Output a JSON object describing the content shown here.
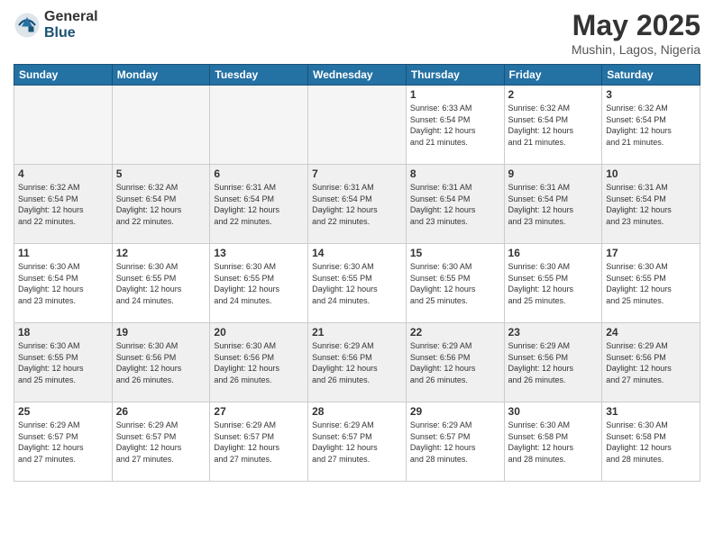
{
  "logo": {
    "general": "General",
    "blue": "Blue"
  },
  "title": "May 2025",
  "location": "Mushin, Lagos, Nigeria",
  "days_of_week": [
    "Sunday",
    "Monday",
    "Tuesday",
    "Wednesday",
    "Thursday",
    "Friday",
    "Saturday"
  ],
  "weeks": [
    [
      {
        "day": "",
        "info": "",
        "empty": true
      },
      {
        "day": "",
        "info": "",
        "empty": true
      },
      {
        "day": "",
        "info": "",
        "empty": true
      },
      {
        "day": "",
        "info": "",
        "empty": true
      },
      {
        "day": "1",
        "info": "Sunrise: 6:33 AM\nSunset: 6:54 PM\nDaylight: 12 hours\nand 21 minutes."
      },
      {
        "day": "2",
        "info": "Sunrise: 6:32 AM\nSunset: 6:54 PM\nDaylight: 12 hours\nand 21 minutes."
      },
      {
        "day": "3",
        "info": "Sunrise: 6:32 AM\nSunset: 6:54 PM\nDaylight: 12 hours\nand 21 minutes."
      }
    ],
    [
      {
        "day": "4",
        "info": "Sunrise: 6:32 AM\nSunset: 6:54 PM\nDaylight: 12 hours\nand 22 minutes."
      },
      {
        "day": "5",
        "info": "Sunrise: 6:32 AM\nSunset: 6:54 PM\nDaylight: 12 hours\nand 22 minutes."
      },
      {
        "day": "6",
        "info": "Sunrise: 6:31 AM\nSunset: 6:54 PM\nDaylight: 12 hours\nand 22 minutes."
      },
      {
        "day": "7",
        "info": "Sunrise: 6:31 AM\nSunset: 6:54 PM\nDaylight: 12 hours\nand 22 minutes."
      },
      {
        "day": "8",
        "info": "Sunrise: 6:31 AM\nSunset: 6:54 PM\nDaylight: 12 hours\nand 23 minutes."
      },
      {
        "day": "9",
        "info": "Sunrise: 6:31 AM\nSunset: 6:54 PM\nDaylight: 12 hours\nand 23 minutes."
      },
      {
        "day": "10",
        "info": "Sunrise: 6:31 AM\nSunset: 6:54 PM\nDaylight: 12 hours\nand 23 minutes."
      }
    ],
    [
      {
        "day": "11",
        "info": "Sunrise: 6:30 AM\nSunset: 6:54 PM\nDaylight: 12 hours\nand 23 minutes."
      },
      {
        "day": "12",
        "info": "Sunrise: 6:30 AM\nSunset: 6:55 PM\nDaylight: 12 hours\nand 24 minutes."
      },
      {
        "day": "13",
        "info": "Sunrise: 6:30 AM\nSunset: 6:55 PM\nDaylight: 12 hours\nand 24 minutes."
      },
      {
        "day": "14",
        "info": "Sunrise: 6:30 AM\nSunset: 6:55 PM\nDaylight: 12 hours\nand 24 minutes."
      },
      {
        "day": "15",
        "info": "Sunrise: 6:30 AM\nSunset: 6:55 PM\nDaylight: 12 hours\nand 25 minutes."
      },
      {
        "day": "16",
        "info": "Sunrise: 6:30 AM\nSunset: 6:55 PM\nDaylight: 12 hours\nand 25 minutes."
      },
      {
        "day": "17",
        "info": "Sunrise: 6:30 AM\nSunset: 6:55 PM\nDaylight: 12 hours\nand 25 minutes."
      }
    ],
    [
      {
        "day": "18",
        "info": "Sunrise: 6:30 AM\nSunset: 6:55 PM\nDaylight: 12 hours\nand 25 minutes."
      },
      {
        "day": "19",
        "info": "Sunrise: 6:30 AM\nSunset: 6:56 PM\nDaylight: 12 hours\nand 26 minutes."
      },
      {
        "day": "20",
        "info": "Sunrise: 6:30 AM\nSunset: 6:56 PM\nDaylight: 12 hours\nand 26 minutes."
      },
      {
        "day": "21",
        "info": "Sunrise: 6:29 AM\nSunset: 6:56 PM\nDaylight: 12 hours\nand 26 minutes."
      },
      {
        "day": "22",
        "info": "Sunrise: 6:29 AM\nSunset: 6:56 PM\nDaylight: 12 hours\nand 26 minutes."
      },
      {
        "day": "23",
        "info": "Sunrise: 6:29 AM\nSunset: 6:56 PM\nDaylight: 12 hours\nand 26 minutes."
      },
      {
        "day": "24",
        "info": "Sunrise: 6:29 AM\nSunset: 6:56 PM\nDaylight: 12 hours\nand 27 minutes."
      }
    ],
    [
      {
        "day": "25",
        "info": "Sunrise: 6:29 AM\nSunset: 6:57 PM\nDaylight: 12 hours\nand 27 minutes."
      },
      {
        "day": "26",
        "info": "Sunrise: 6:29 AM\nSunset: 6:57 PM\nDaylight: 12 hours\nand 27 minutes."
      },
      {
        "day": "27",
        "info": "Sunrise: 6:29 AM\nSunset: 6:57 PM\nDaylight: 12 hours\nand 27 minutes."
      },
      {
        "day": "28",
        "info": "Sunrise: 6:29 AM\nSunset: 6:57 PM\nDaylight: 12 hours\nand 27 minutes."
      },
      {
        "day": "29",
        "info": "Sunrise: 6:29 AM\nSunset: 6:57 PM\nDaylight: 12 hours\nand 28 minutes."
      },
      {
        "day": "30",
        "info": "Sunrise: 6:30 AM\nSunset: 6:58 PM\nDaylight: 12 hours\nand 28 minutes."
      },
      {
        "day": "31",
        "info": "Sunrise: 6:30 AM\nSunset: 6:58 PM\nDaylight: 12 hours\nand 28 minutes."
      }
    ]
  ]
}
